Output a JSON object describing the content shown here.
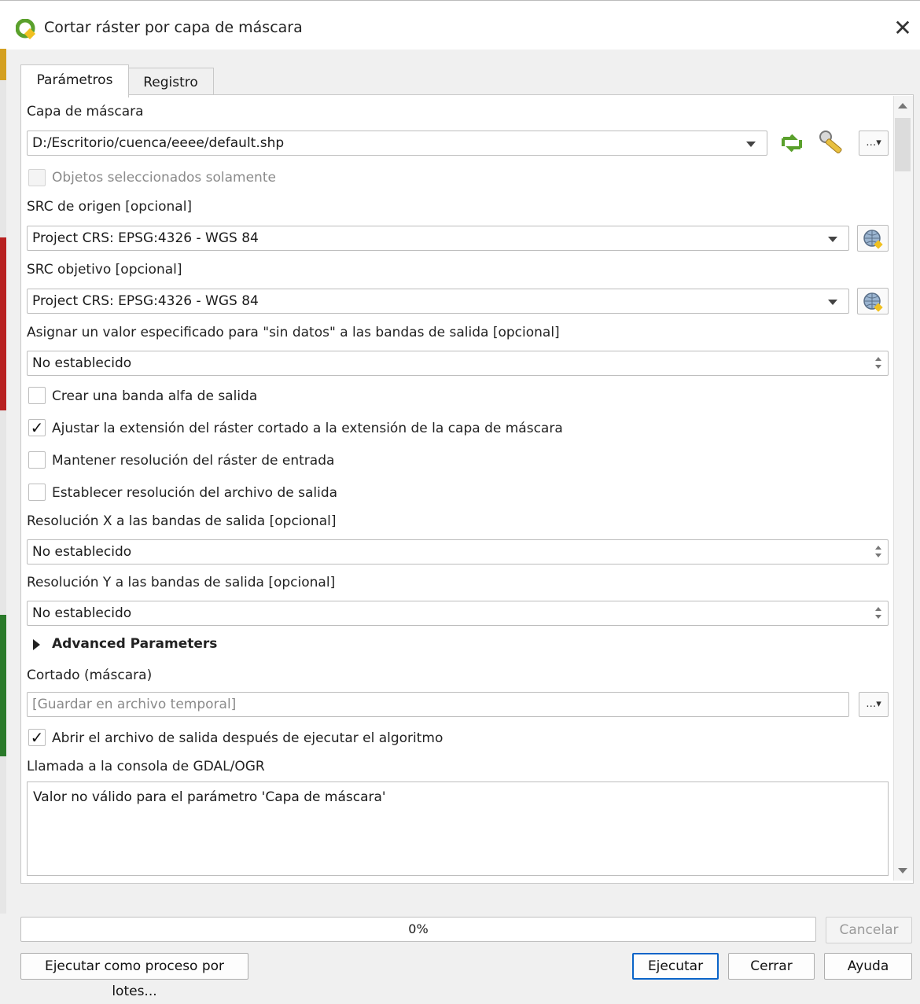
{
  "window": {
    "title": "Cortar ráster por capa de máscara",
    "close_glyph": "✕"
  },
  "tabs": [
    {
      "label": "Parámetros",
      "active": true
    },
    {
      "label": "Registro",
      "active": false
    }
  ],
  "params": {
    "mask_layer_label": "Capa de máscara",
    "mask_layer_value": "D:/Escritorio/cuenca/eeee/default.shp",
    "selected_only_label": "Objetos seleccionados solamente",
    "source_crs_label": "SRC de origen [opcional]",
    "source_crs_value": "Project CRS: EPSG:4326 - WGS 84",
    "target_crs_label": "SRC objetivo [opcional]",
    "target_crs_value": "Project CRS: EPSG:4326 - WGS 84",
    "nodata_label": "Asignar un valor especificado para \"sin datos\" a las bandas de salida [opcional]",
    "nodata_value": "No establecido",
    "alpha_band_label": "Crear una banda alfa de salida",
    "alpha_band_checked": false,
    "crop_extent_label": "Ajustar la extensión del ráster cortado a la extensión de la capa de máscara",
    "crop_extent_checked": true,
    "keep_resolution_label": "Mantener resolución del ráster de entrada",
    "keep_resolution_checked": false,
    "set_resolution_label": "Establecer resolución del archivo de salida",
    "set_resolution_checked": false,
    "xres_label": "Resolución X a las bandas de salida [opcional]",
    "xres_value": "No establecido",
    "yres_label": "Resolución Y a las bandas de salida [opcional]",
    "yres_value": "No establecido",
    "advanced_label": "Advanced Parameters",
    "output_label": "Cortado (máscara)",
    "output_placeholder": "[Guardar en archivo temporal]",
    "open_output_label": "Abrir el archivo de salida después de ejecutar el algoritmo",
    "open_output_checked": true,
    "console_label": "Llamada a la consola de GDAL/OGR",
    "console_text": "Valor no válido para el parámetro 'Capa de máscara'",
    "browse_glyph": "…▾",
    "check_glyph": "✓"
  },
  "footer": {
    "progress_text": "0%",
    "progress_fraction": 0,
    "cancel_label": "Cancelar",
    "batch_label": "Ejecutar como proceso por lotes...",
    "run_label": "Ejecutar",
    "close_label": "Cerrar",
    "help_label": "Ayuda"
  },
  "icons": {
    "app": "qgis-logo-icon",
    "refresh": "iterate-refresh-icon",
    "settings": "wrench-icon",
    "crs": "globe-crs-icon"
  },
  "colors": {
    "qgis_green": "#5aa02c",
    "default_button_border": "#0a64c8"
  }
}
